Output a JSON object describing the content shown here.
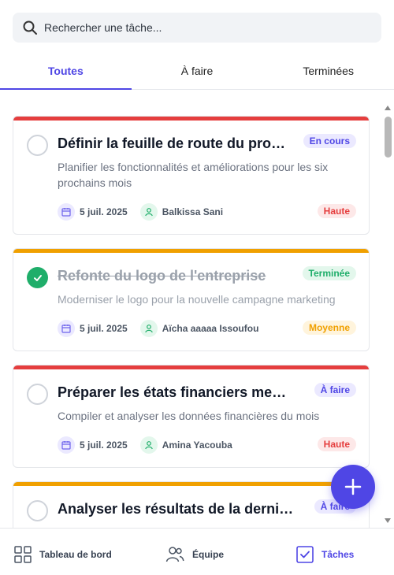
{
  "search": {
    "placeholder": "Rechercher une tâche..."
  },
  "tabs": [
    {
      "label": "Toutes",
      "active": true
    },
    {
      "label": "À faire",
      "active": false
    },
    {
      "label": "Terminées",
      "active": false
    }
  ],
  "tasks": [
    {
      "title": "Définir la feuille de route du produit",
      "status": "En cours",
      "description": "Planifier les fonctionnalités et améliorations pour les six prochains mois",
      "date": "5 juil. 2025",
      "assignee": "Balkissa Sani",
      "priority": "Haute",
      "completed": false,
      "accent_color": "#e53e3e"
    },
    {
      "title": "Refonte du logo de l'entreprise",
      "status": "Terminée",
      "description": "Moderniser le logo pour la nouvelle campagne marketing",
      "date": "5 juil. 2025",
      "assignee": "Aïcha aaaaa Issoufou",
      "priority": "Moyenne",
      "completed": true,
      "accent_color": "#f0a000"
    },
    {
      "title": "Préparer les états financiers mensuels",
      "status": "À faire",
      "description": "Compiler et analyser les données financières du mois",
      "date": "5 juil. 2025",
      "assignee": "Amina Yacouba",
      "priority": "Haute",
      "completed": false,
      "accent_color": "#e53e3e"
    },
    {
      "title": "Analyser les résultats de la dernière campagne",
      "status": "À faire",
      "description": "",
      "completed": false,
      "accent_color": "#f0a000"
    }
  ],
  "bottom_nav": [
    {
      "label": "Tableau de bord",
      "icon": "grid-icon",
      "active": false
    },
    {
      "label": "Équipe",
      "icon": "users-icon",
      "active": false
    },
    {
      "label": "Tâches",
      "icon": "checkbox-icon",
      "active": true
    }
  ],
  "colors": {
    "primary": "#4f46e5",
    "status_in_progress_bg": "#ebe9ff",
    "status_done_bg": "#e3f7ec",
    "status_done_text": "#1fae6a",
    "priority_high_bg": "#fde8e8",
    "priority_high_text": "#e53e3e",
    "priority_medium_bg": "#fff4dc",
    "priority_medium_text": "#f0a000"
  }
}
